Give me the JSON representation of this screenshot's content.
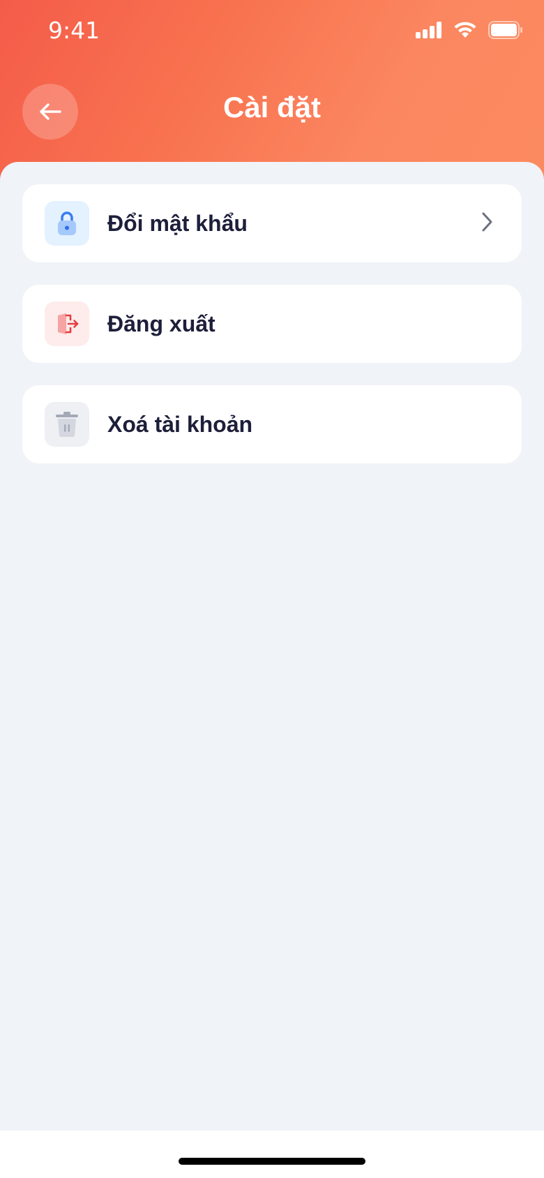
{
  "status_bar": {
    "time": "9:41"
  },
  "header": {
    "title": "Cài đặt"
  },
  "menu": {
    "items": [
      {
        "label": "Đổi mật khẩu",
        "icon": "lock-icon",
        "icon_bg": "#e4f1ff",
        "has_chevron": true
      },
      {
        "label": "Đăng xuất",
        "icon": "logout-icon",
        "icon_bg": "#fdeceb",
        "has_chevron": false
      },
      {
        "label": "Xoá tài khoản",
        "icon": "trash-icon",
        "icon_bg": "#eef0f4",
        "has_chevron": false
      }
    ]
  },
  "colors": {
    "header_start": "#f45c4a",
    "header_end": "#fc8a60",
    "background": "#f0f3f7",
    "text": "#1d1f3a"
  }
}
